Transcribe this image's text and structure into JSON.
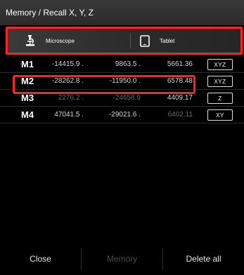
{
  "window": {
    "title": "Memory / Recall X, Y, Z"
  },
  "sources": [
    {
      "label": "Microscope",
      "icon": "microscope-icon"
    },
    {
      "label": "Tablet",
      "icon": "tablet-icon"
    }
  ],
  "memories": [
    {
      "label": "M1",
      "x": "-14415.9 .",
      "y": "9863.5 .",
      "z": "5661.36",
      "axes": "XYZ",
      "x_state": "bright",
      "y_state": "bright",
      "z_state": "bright"
    },
    {
      "label": "M2",
      "x": "-28262.8 .",
      "y": "-11950.0 .",
      "z": "6578.48",
      "axes": "XYZ",
      "x_state": "bright",
      "y_state": "bright",
      "z_state": "bright"
    },
    {
      "label": "M3",
      "x": "2276.2 .",
      "y": "-24658.9",
      "z": "4409.17",
      "axes": "Z",
      "x_state": "dim",
      "y_state": "dim",
      "z_state": "bright"
    },
    {
      "label": "M4",
      "x": "47041.5 .",
      "y": "-29021.6 .",
      "z": "6402.11",
      "axes": "XY",
      "x_state": "bright",
      "y_state": "bright",
      "z_state": "dim"
    }
  ],
  "footer": {
    "close": "Close",
    "memory": "Memory",
    "delete_all": "Delete all"
  },
  "colors": {
    "highlight": "#ff2222",
    "background": "#000000",
    "dim_text": "#6a6a6a"
  }
}
